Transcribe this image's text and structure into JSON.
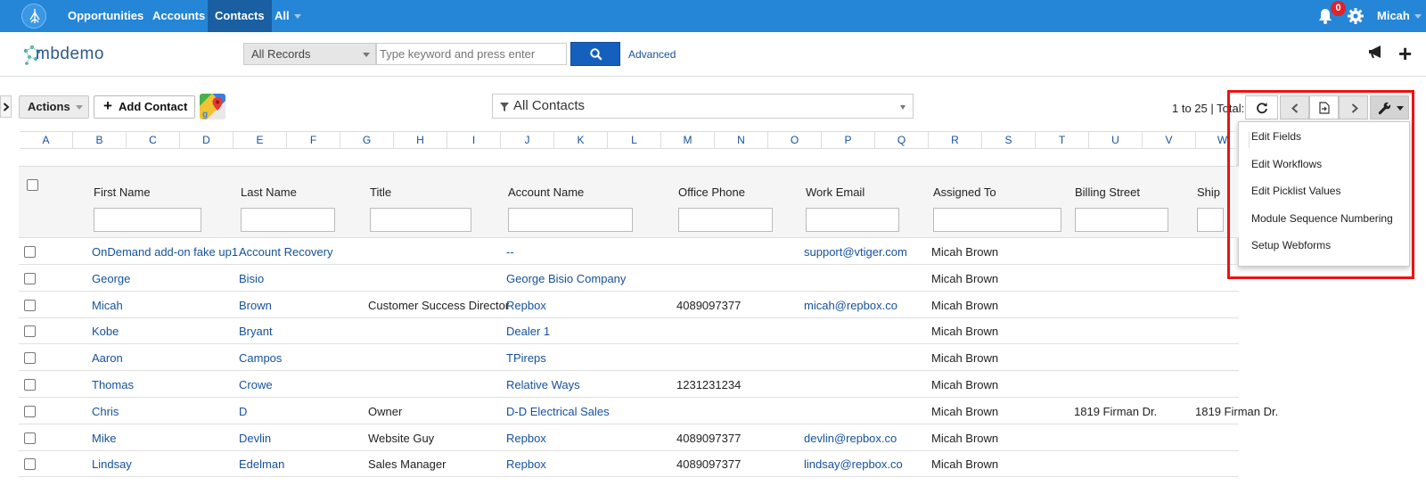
{
  "nav": {
    "items": [
      {
        "label": "Opportunities",
        "active": false
      },
      {
        "label": "Accounts",
        "active": false
      },
      {
        "label": "Contacts",
        "active": true
      },
      {
        "label": "All",
        "active": false
      }
    ],
    "notification_count": "0",
    "user_name": "Micah"
  },
  "subbar": {
    "brand": "mbdemo",
    "records_select": "All Records",
    "search_placeholder": "Type keyword and press enter",
    "advanced_label": "Advanced"
  },
  "toolbar": {
    "actions_label": "Actions",
    "add_contact_label": "Add Contact",
    "filter_label": "All Contacts",
    "page_info": "1 to 25 | Total:"
  },
  "settings_menu": {
    "items": [
      "Edit Fields",
      "Edit Workflows",
      "Edit Picklist Values",
      "Module Sequence Numbering",
      "Setup Webforms"
    ]
  },
  "alphabet": [
    "A",
    "B",
    "C",
    "D",
    "E",
    "F",
    "G",
    "H",
    "I",
    "J",
    "K",
    "L",
    "M",
    "N",
    "O",
    "P",
    "Q",
    "R",
    "S",
    "T",
    "U",
    "V",
    "W"
  ],
  "table": {
    "columns": [
      "First Name",
      "Last Name",
      "Title",
      "Account Name",
      "Office Phone",
      "Work Email",
      "Assigned To",
      "Billing Street",
      "Ship"
    ],
    "rows": [
      {
        "first": "OnDemand add-on fake up1",
        "last": "Account Recovery",
        "title": "",
        "account": "--",
        "phone": "",
        "email": "support@vtiger.com",
        "assigned": "Micah Brown",
        "billing": "",
        "ship": ""
      },
      {
        "first": "George",
        "last": "Bisio",
        "title": "",
        "account": "George Bisio Company",
        "phone": "",
        "email": "",
        "assigned": "Micah Brown",
        "billing": "",
        "ship": ""
      },
      {
        "first": "Micah",
        "last": "Brown",
        "title": "Customer Success Director",
        "account": "Repbox",
        "phone": "4089097377",
        "email": "micah@repbox.co",
        "assigned": "Micah Brown",
        "billing": "",
        "ship": ""
      },
      {
        "first": "Kobe",
        "last": "Bryant",
        "title": "",
        "account": "Dealer 1",
        "phone": "",
        "email": "",
        "assigned": "Micah Brown",
        "billing": "",
        "ship": ""
      },
      {
        "first": "Aaron",
        "last": "Campos",
        "title": "",
        "account": "TPireps",
        "phone": "",
        "email": "",
        "assigned": "Micah Brown",
        "billing": "",
        "ship": ""
      },
      {
        "first": "Thomas",
        "last": "Crowe",
        "title": "",
        "account": "Relative Ways",
        "phone": "1231231234",
        "email": "",
        "assigned": "Micah Brown",
        "billing": "",
        "ship": ""
      },
      {
        "first": "Chris",
        "last": "D",
        "title": "Owner",
        "account": "D-D Electrical Sales",
        "phone": "",
        "email": "",
        "assigned": "Micah Brown",
        "billing": "1819 Firman Dr.",
        "ship": "1819 Firman Dr."
      },
      {
        "first": "Mike",
        "last": "Devlin",
        "title": "Website Guy",
        "account": "Repbox",
        "phone": "4089097377",
        "email": "devlin@repbox.co",
        "assigned": "Micah Brown",
        "billing": "",
        "ship": ""
      },
      {
        "first": "Lindsay",
        "last": "Edelman",
        "title": "Sales Manager",
        "account": "Repbox",
        "phone": "4089097377",
        "email": "lindsay@repbox.co",
        "assigned": "Micah Brown",
        "billing": "",
        "ship": ""
      }
    ]
  },
  "colors": {
    "nav_bg": "#2586d8",
    "nav_active": "#1a5fa2",
    "link": "#15519c",
    "search_button": "#1560bd",
    "highlight": "#ee1111"
  }
}
